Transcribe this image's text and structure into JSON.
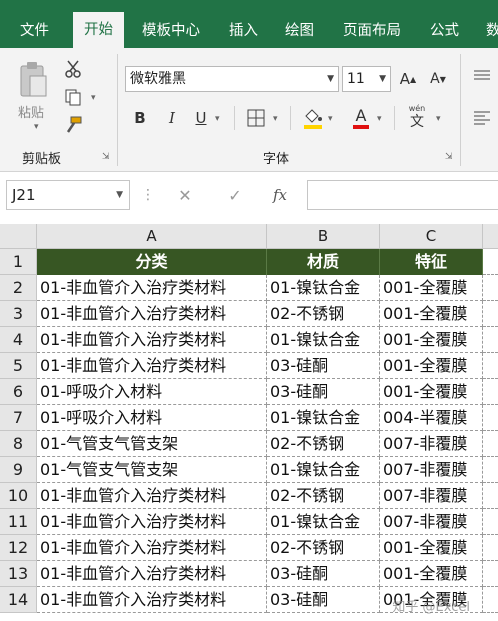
{
  "ribbon_tabs": [
    "文件",
    "开始",
    "模板中心",
    "插入",
    "绘图",
    "页面布局",
    "公式",
    "数"
  ],
  "active_tab": "开始",
  "clipboard": {
    "paste_label": "粘贴",
    "group_label": "剪贴板"
  },
  "font": {
    "name": "微软雅黑",
    "size": "11",
    "group_label": "字体",
    "bold": "B",
    "italic": "I",
    "underline": "U",
    "grow": "A",
    "shrink": "A",
    "font_color": "A",
    "phonetic": "wén"
  },
  "formula_bar": {
    "name_box": "J21",
    "fx": "fx",
    "value": ""
  },
  "columns": [
    "A",
    "B",
    "C"
  ],
  "table": {
    "headers": [
      "分类",
      "材质",
      "特征"
    ],
    "rows": [
      [
        "01-非血管介入治疗类材料",
        "01-镍钛合金",
        "001-全覆膜"
      ],
      [
        "01-非血管介入治疗类材料",
        "02-不锈钢",
        "001-全覆膜"
      ],
      [
        "01-非血管介入治疗类材料",
        "01-镍钛合金",
        "001-全覆膜"
      ],
      [
        "01-非血管介入治疗类材料",
        "03-硅酮",
        "001-全覆膜"
      ],
      [
        "01-呼吸介入材料",
        "03-硅酮",
        "001-全覆膜"
      ],
      [
        "01-呼吸介入材料",
        "01-镍钛合金",
        "004-半覆膜"
      ],
      [
        "01-气管支气管支架",
        "02-不锈钢",
        "007-非覆膜"
      ],
      [
        "01-气管支气管支架",
        "01-镍钛合金",
        "007-非覆膜"
      ],
      [
        "01-非血管介入治疗类材料",
        "02-不锈钢",
        "007-非覆膜"
      ],
      [
        "01-非血管介入治疗类材料",
        "01-镍钛合金",
        "007-非覆膜"
      ],
      [
        "01-非血管介入治疗类材料",
        "02-不锈钢",
        "001-全覆膜"
      ],
      [
        "01-非血管介入治疗类材料",
        "03-硅酮",
        "001-全覆膜"
      ],
      [
        "01-非血管介入治疗类材料",
        "03-硅酮",
        "001-全覆膜"
      ]
    ]
  },
  "row_numbers": [
    "1",
    "2",
    "3",
    "4",
    "5",
    "6",
    "7",
    "8",
    "9",
    "10",
    "11",
    "12",
    "13",
    "14"
  ],
  "watermark": "知乎 @Excel",
  "colors": {
    "ribbon_green": "#217346",
    "header_fill": "#375623",
    "header_text": "#ffffff"
  }
}
